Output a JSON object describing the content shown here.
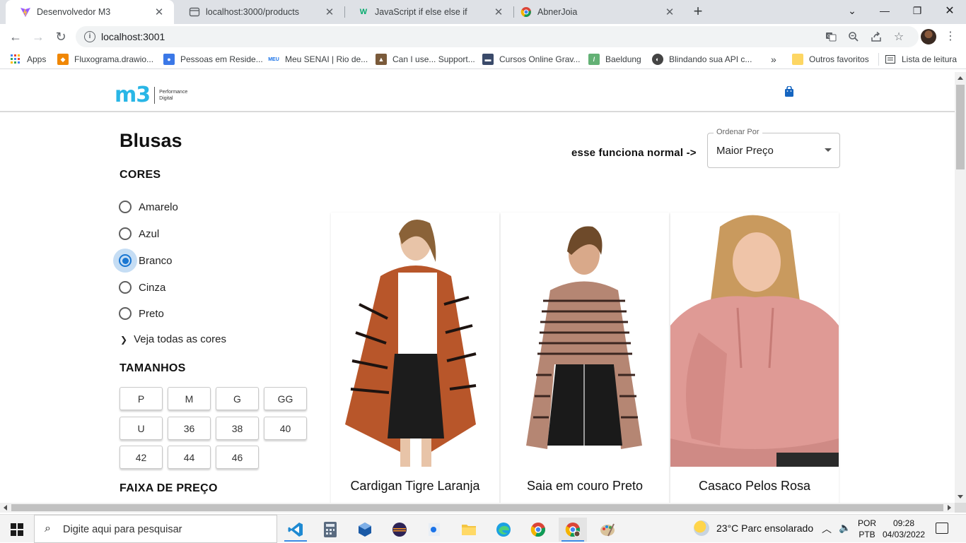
{
  "browser": {
    "tabs": [
      {
        "title": "Desenvolvedor M3",
        "active": true,
        "favicon": "vite-icon"
      },
      {
        "title": "localhost:3000/products",
        "active": false,
        "favicon": "globe-icon"
      },
      {
        "title": "JavaScript if else else if",
        "active": false,
        "favicon": "w3-icon"
      },
      {
        "title": "AbnerJoia",
        "active": false,
        "favicon": "chrome-icon"
      }
    ],
    "url": "localhost:3001",
    "bookmarks": [
      {
        "label": "Apps",
        "icon": "apps-grid-icon"
      },
      {
        "label": "Fluxograma.drawio...",
        "icon": "drawio-icon"
      },
      {
        "label": "Pessoas em Reside...",
        "icon": "people-icon"
      },
      {
        "label": "Meu SENAI | Rio de...",
        "icon": "senai-icon"
      },
      {
        "label": "Can I use... Support...",
        "icon": "caniuse-icon"
      },
      {
        "label": "Cursos Online Grav...",
        "icon": "courses-icon"
      },
      {
        "label": "Baeldung",
        "icon": "baeldung-icon"
      },
      {
        "label": "Blindando sua API c...",
        "icon": "globe-icon"
      },
      {
        "label": "Outros favoritos",
        "icon": "folder-icon"
      },
      {
        "label": "Lista de leitura",
        "icon": "reading-list-icon"
      }
    ],
    "overflow": "»"
  },
  "site": {
    "logo": {
      "mark": "m3",
      "tagline_1": "Performance",
      "tagline_2": "Digital"
    },
    "title": "Blusas",
    "colors_heading": "CORES",
    "colors": [
      {
        "label": "Amarelo",
        "checked": false
      },
      {
        "label": "Azul",
        "checked": false
      },
      {
        "label": "Branco",
        "checked": true
      },
      {
        "label": "Cinza",
        "checked": false
      },
      {
        "label": "Preto",
        "checked": false
      }
    ],
    "see_all_colors": "Veja todas as cores",
    "sizes_heading": "TAMANHOS",
    "sizes": [
      "P",
      "M",
      "G",
      "GG",
      "U",
      "36",
      "38",
      "40",
      "42",
      "44",
      "46"
    ],
    "price_heading": "FAIXA DE PREÇO",
    "sort_note": "esse funciona normal ->",
    "sort": {
      "legend": "Ordenar Por",
      "value": "Maior Preço"
    },
    "products": [
      {
        "name": "Cardigan Tigre Laranja"
      },
      {
        "name": "Saia em couro Preto"
      },
      {
        "name": "Casaco Pelos Rosa"
      }
    ],
    "accent_color": "#1976d2",
    "brand_color": "#29b6e6"
  },
  "taskbar": {
    "search_placeholder": "Digite aqui para pesquisar",
    "weather": "23°C  Parc ensolarado",
    "lang_1": "POR",
    "lang_2": "PTB",
    "time": "09:28",
    "date": "04/03/2022"
  }
}
